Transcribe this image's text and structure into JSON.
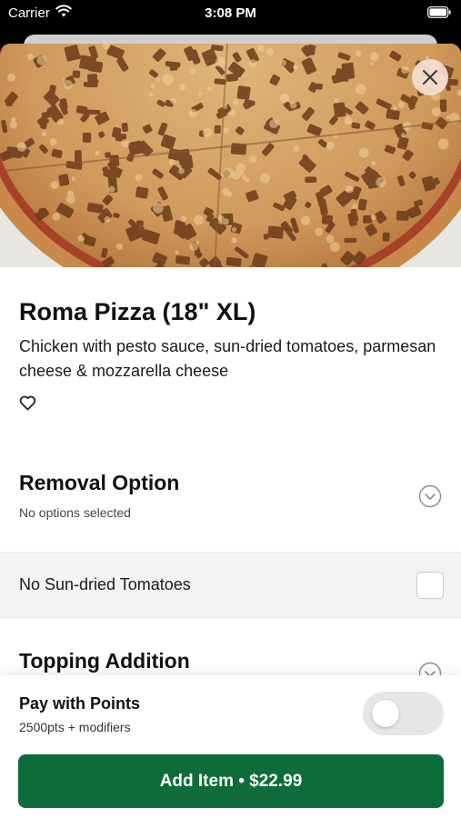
{
  "status_bar": {
    "carrier": "Carrier",
    "time": "3:08 PM",
    "icons": [
      "wifi-icon",
      "battery-icon"
    ]
  },
  "hero": {
    "image": "pizza-photo",
    "close_icon": "close-icon"
  },
  "product": {
    "name": "Roma Pizza (18\" XL)",
    "description": "Chicken with pesto sauce, sun-dried tomatoes, parmesan cheese & mozzarella cheese",
    "favorite_icon": "heart-outline-icon"
  },
  "sections": {
    "removal": {
      "title": "Removal Option",
      "subtitle": "No options selected",
      "options": [
        {
          "label": "No Sun-dried Tomatoes",
          "checked": false
        }
      ]
    },
    "topping": {
      "title": "Topping Addition"
    }
  },
  "footer": {
    "points_title": "Pay with Points",
    "points_subtitle": "2500pts + modifiers",
    "points_enabled": false,
    "add_button_label": "Add Item • $22.99"
  },
  "colors": {
    "primary_button": "#0e6b3a",
    "option_row_bg": "#f3f3f3",
    "toggle_off": "#e6e6e6"
  }
}
